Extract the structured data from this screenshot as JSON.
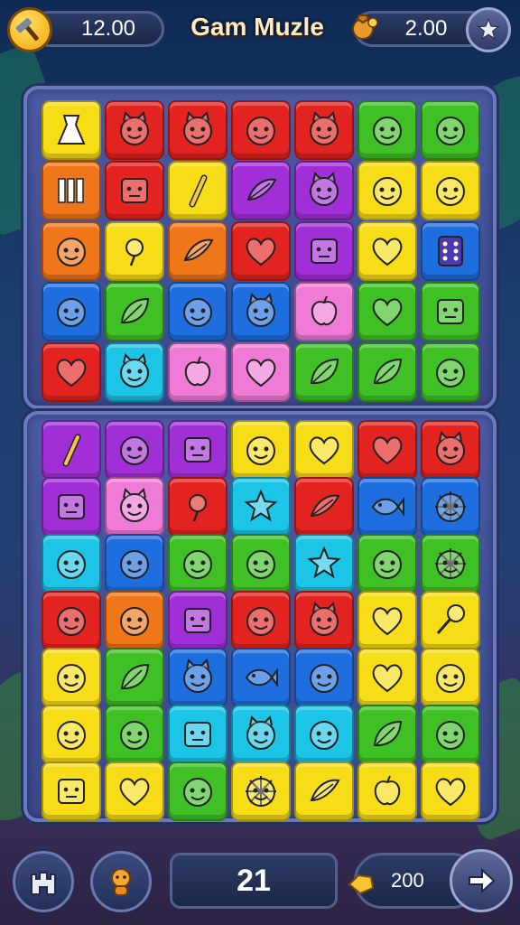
{
  "header": {
    "score_value": "12.00",
    "title": "Gam Muzle",
    "coins_value": "2.00",
    "left_icon": "hammer-icon",
    "coin_icon": "coin-bag-icon",
    "settings_icon": "star-icon"
  },
  "footer": {
    "moves_value": "21",
    "reward_value": "200",
    "castle_icon": "castle-icon",
    "character_icon": "character-icon",
    "next_icon": "arrow-right-icon"
  },
  "colors": {
    "red": "#e2231f",
    "orange": "#f0761a",
    "yellow": "#f7dc18",
    "green": "#3fc126",
    "cyan": "#1cc4e6",
    "blue": "#1f6ee0",
    "purple": "#a12fd8",
    "pink": "#f07bd6",
    "accent_text": "#ffeac2"
  },
  "board_top": [
    [
      {
        "c": "yellow",
        "i": "dress-icon"
      },
      {
        "c": "red",
        "i": "bunny-face-icon"
      },
      {
        "c": "red",
        "i": "cat-face-icon"
      },
      {
        "c": "red",
        "i": "smiley-icon"
      },
      {
        "c": "red",
        "i": "monster-face-icon"
      },
      {
        "c": "green",
        "i": "smiley-icon"
      },
      {
        "c": "green",
        "i": "blob-face-icon"
      }
    ],
    [
      {
        "c": "orange",
        "i": "bars-icon"
      },
      {
        "c": "red",
        "i": "box-face-icon"
      },
      {
        "c": "yellow",
        "i": "stick-icon"
      },
      {
        "c": "purple",
        "i": "bird-icon"
      },
      {
        "c": "purple",
        "i": "cat-face-icon"
      },
      {
        "c": "yellow",
        "i": "star-face-icon"
      },
      {
        "c": "yellow",
        "i": "apple-face-icon"
      }
    ],
    [
      {
        "c": "orange",
        "i": "smiley-icon"
      },
      {
        "c": "yellow",
        "i": "flower-icon"
      },
      {
        "c": "orange",
        "i": "feather-icon"
      },
      {
        "c": "red",
        "i": "heart-icon"
      },
      {
        "c": "purple",
        "i": "box-face-icon"
      },
      {
        "c": "yellow",
        "i": "heart-icon"
      },
      {
        "c": "blue",
        "i": "dice-icon"
      }
    ],
    [
      {
        "c": "blue",
        "i": "smiley-icon"
      },
      {
        "c": "green",
        "i": "shell-icon"
      },
      {
        "c": "blue",
        "i": "smiley-icon"
      },
      {
        "c": "blue",
        "i": "monster-face-icon"
      },
      {
        "c": "pink",
        "i": "apple-icon"
      },
      {
        "c": "green",
        "i": "heart-icon"
      },
      {
        "c": "green",
        "i": "box-face-icon"
      }
    ],
    [
      {
        "c": "red",
        "i": "heart-icon"
      },
      {
        "c": "cyan",
        "i": "cat-face-icon"
      },
      {
        "c": "pink",
        "i": "apple-icon"
      },
      {
        "c": "pink",
        "i": "heart-icon"
      },
      {
        "c": "green",
        "i": "leaf-icon"
      },
      {
        "c": "green",
        "i": "leaf-icon"
      },
      {
        "c": "green",
        "i": "blob-face-icon"
      }
    ]
  ],
  "board_bottom": [
    [
      {
        "c": "purple",
        "i": "stick-icon"
      },
      {
        "c": "purple",
        "i": "smiley-icon"
      },
      {
        "c": "purple",
        "i": "box-face-icon"
      },
      {
        "c": "yellow",
        "i": "apple-face-icon"
      },
      {
        "c": "yellow",
        "i": "heart-icon"
      },
      {
        "c": "red",
        "i": "heart-icon"
      },
      {
        "c": "red",
        "i": "bear-face-icon"
      }
    ],
    [
      {
        "c": "purple",
        "i": "box-face-icon"
      },
      {
        "c": "pink",
        "i": "cat-face-icon"
      },
      {
        "c": "red",
        "i": "rose-icon"
      },
      {
        "c": "cyan",
        "i": "star-icon"
      },
      {
        "c": "red",
        "i": "feather-icon"
      },
      {
        "c": "blue",
        "i": "fish-icon"
      },
      {
        "c": "blue",
        "i": "sun-face-icon"
      }
    ],
    [
      {
        "c": "cyan",
        "i": "star-face-icon"
      },
      {
        "c": "blue",
        "i": "smiley-icon"
      },
      {
        "c": "green",
        "i": "tomato-icon"
      },
      {
        "c": "green",
        "i": "tomato-icon"
      },
      {
        "c": "cyan",
        "i": "star-gem-icon"
      },
      {
        "c": "green",
        "i": "apple-face-icon"
      },
      {
        "c": "green",
        "i": "sun-face-icon"
      }
    ],
    [
      {
        "c": "red",
        "i": "smiley-icon"
      },
      {
        "c": "orange",
        "i": "smiley-icon"
      },
      {
        "c": "purple",
        "i": "box-face-icon"
      },
      {
        "c": "red",
        "i": "smiley-icon"
      },
      {
        "c": "red",
        "i": "monster-face-icon"
      },
      {
        "c": "yellow",
        "i": "heart-icon"
      },
      {
        "c": "yellow",
        "i": "lollipop-icon"
      }
    ],
    [
      {
        "c": "yellow",
        "i": "blob-face-icon"
      },
      {
        "c": "green",
        "i": "shell-icon"
      },
      {
        "c": "blue",
        "i": "cat-face-icon"
      },
      {
        "c": "blue",
        "i": "fish-icon"
      },
      {
        "c": "blue",
        "i": "blob-face-icon"
      },
      {
        "c": "yellow",
        "i": "heart-icon"
      },
      {
        "c": "yellow",
        "i": "apple-face-icon"
      }
    ],
    [
      {
        "c": "yellow",
        "i": "strawberry-face-icon"
      },
      {
        "c": "green",
        "i": "smiley-icon"
      },
      {
        "c": "cyan",
        "i": "box-face-icon"
      },
      {
        "c": "cyan",
        "i": "cat-face-icon"
      },
      {
        "c": "cyan",
        "i": "blob-face-icon"
      },
      {
        "c": "green",
        "i": "leaf-icon"
      },
      {
        "c": "green",
        "i": "blob-face-icon"
      }
    ],
    [
      {
        "c": "yellow",
        "i": "box-face-icon"
      },
      {
        "c": "yellow",
        "i": "heart-icon"
      },
      {
        "c": "green",
        "i": "apple-face-icon"
      },
      {
        "c": "yellow",
        "i": "sun-face-icon"
      },
      {
        "c": "yellow",
        "i": "feather-icon"
      },
      {
        "c": "yellow",
        "i": "pear-icon"
      },
      {
        "c": "yellow",
        "i": "heart-icon"
      }
    ]
  ]
}
